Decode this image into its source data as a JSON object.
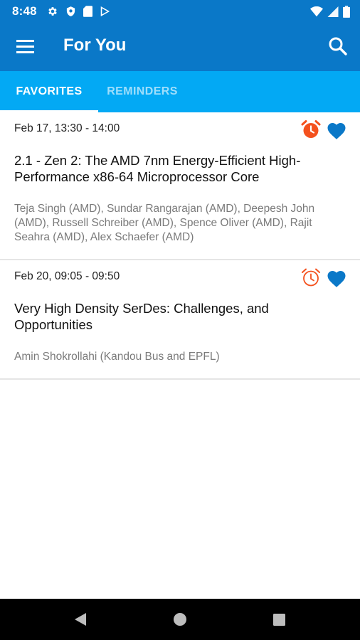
{
  "status_bar": {
    "time": "8:48",
    "left_icons": [
      "gear-icon",
      "shield-icon",
      "sd-card-icon",
      "play-store-icon"
    ],
    "right_icons": [
      "wifi-icon",
      "cell-signal-icon",
      "battery-icon"
    ]
  },
  "app_bar": {
    "title": "For You",
    "menu_icon": "hamburger-menu-icon",
    "search_icon": "search-icon"
  },
  "tabs": [
    {
      "label": "FAVORITES",
      "selected": true
    },
    {
      "label": "REMINDERS",
      "selected": false
    }
  ],
  "sessions": [
    {
      "time": "Feb 17, 13:30 - 14:00",
      "title": "2.1 - Zen 2: The AMD 7nm Energy-Efficient High-Performance x86-64 Microprocessor Core",
      "authors": "Teja Singh (AMD), Sundar Rangarajan (AMD), Deepesh John (AMD), Russell Schreiber (AMD), Spence Oliver (AMD), Rajit Seahra (AMD), Alex Schaefer (AMD)",
      "reminder_set": true,
      "favorite": true
    },
    {
      "time": "Feb 20, 09:05 - 09:50",
      "title": "Very High Density SerDes: Challenges, and Opportunities",
      "authors": "Amin Shokrollahi (Kandou Bus and EPFL)",
      "reminder_set": false,
      "favorite": true
    }
  ],
  "colors": {
    "app_bar": "#0a78c8",
    "tab_bar": "#03a9f4",
    "alarm_active": "#f4511e",
    "alarm_inactive": "#f4511e",
    "favorite": "#0a78c8"
  },
  "nav_bar": {
    "icons": [
      "back-icon",
      "home-icon",
      "recents-icon"
    ]
  }
}
